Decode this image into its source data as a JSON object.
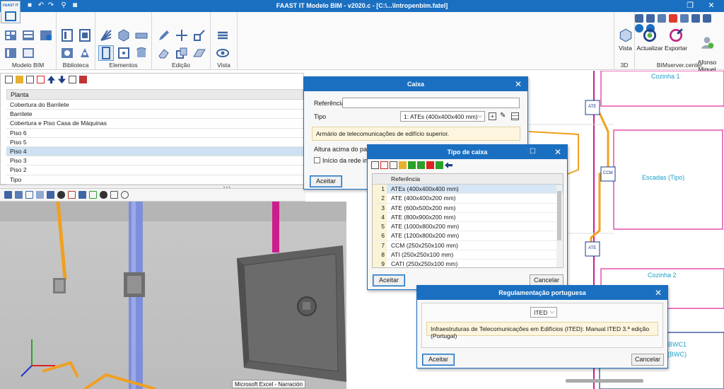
{
  "window": {
    "title": "FAAST IT Modelo BIM - v2020.c - [C:\\...\\Intropenbim.fatel]",
    "logo_text": "FAAST IT"
  },
  "ribbon": {
    "groups": [
      {
        "label": "Modelo BIM"
      },
      {
        "label": "Biblioteca"
      },
      {
        "label": "Elementos"
      },
      {
        "label": "Edição"
      },
      {
        "label": "Vista"
      },
      {
        "label": "3D"
      },
      {
        "label": "BIMserver.center"
      }
    ],
    "view_button": "Vista",
    "update_button": "Actualizar",
    "export_button": "Exportar",
    "user_name": "Afonso\nMiguel Solak"
  },
  "floors": {
    "header": "Planta",
    "items": [
      "Cobertura do Barrilete",
      "Barrilete",
      "Cobertura e Piso Casa de Máquinas",
      "Piso 6",
      "Piso 5",
      "Piso 4",
      "Piso 3",
      "Piso 2",
      "Tipo"
    ],
    "selected": "Piso 4"
  },
  "plan": {
    "rooms": [
      "Cozinha 1",
      "Escadas (Tipo)",
      "Cozinha 2",
      "BWC1",
      "(BWC)"
    ],
    "tags": [
      "ATE",
      "CCM",
      "ATE"
    ]
  },
  "taskbar_tip": "Microsoft Excel - Narración",
  "dialog_caixa": {
    "title": "Caixa",
    "ref_label": "Referência",
    "ref_value": "",
    "tipo_label": "Tipo",
    "tipo_value": "1: ATEs (400x400x400 mm)",
    "description": "Armário de telecomunicações de edifício superior.",
    "height_label": "Altura acima do pavimento",
    "start_label": "Início da rede individual",
    "ok_label": "Aceitar"
  },
  "dialog_tipo": {
    "title": "Tipo de caixa",
    "col_ref": "Referência",
    "rows": [
      {
        "n": "1",
        "ref": "ATEs (400x400x400 mm)"
      },
      {
        "n": "2",
        "ref": "ATE (400x400x200 mm)"
      },
      {
        "n": "3",
        "ref": "ATE (600x500x200 mm)"
      },
      {
        "n": "4",
        "ref": "ATE (800x900x200 mm)"
      },
      {
        "n": "5",
        "ref": "ATE (1000x800x200 mm)"
      },
      {
        "n": "6",
        "ref": "ATE (1200x800x200 mm)"
      },
      {
        "n": "7",
        "ref": "CCM (250x250x100 mm)"
      },
      {
        "n": "8",
        "ref": "ATI (250x250x100 mm)"
      },
      {
        "n": "9",
        "ref": "CATI (250x250x100 mm)"
      }
    ],
    "selected_row": "1",
    "ok_label": "Aceitar",
    "cancel_label": "Cancelar"
  },
  "dialog_reg": {
    "title": "Regulamentação portuguesa",
    "select_value": "ITED",
    "description": "Infraestruturas de Telecomunicações em Edifícios (ITED): Manual ITED 3.ª edição (Portugal)",
    "ok_label": "Aceitar",
    "cancel_label": "Cancelar"
  },
  "colors": {
    "title_bar": "#1a6fc1",
    "selection": "#cde1f3",
    "pipe_orange": "#f0a020",
    "pipe_magenta": "#cc1d8f",
    "pipe_blue": "#7d8fd8",
    "room_outline": "#e0249a"
  }
}
